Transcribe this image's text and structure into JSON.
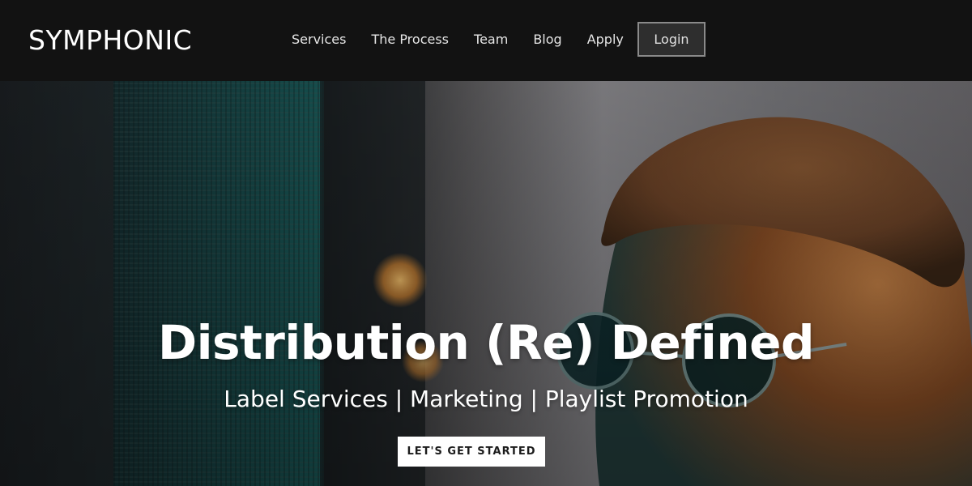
{
  "brand": {
    "name": "SYMPHONIC"
  },
  "nav": {
    "items": [
      {
        "label": "Services"
      },
      {
        "label": "The Process"
      },
      {
        "label": "Team"
      },
      {
        "label": "Blog"
      },
      {
        "label": "Apply"
      }
    ],
    "login_label": "Login"
  },
  "hero": {
    "title": "Distribution (Re) Defined",
    "subtitle": "Label Services | Marketing | Playlist Promotion",
    "cta_label": "LET'S GET STARTED",
    "image": "musician-with-round-sunglasses-and-knit-beanie"
  },
  "colors": {
    "header_bg": "#121212",
    "text": "#ffffff",
    "login_border": "#8a8a8a",
    "cta_bg": "#ffffff",
    "teal_light": "#1a8f8c",
    "warm_orange": "#c27533"
  }
}
